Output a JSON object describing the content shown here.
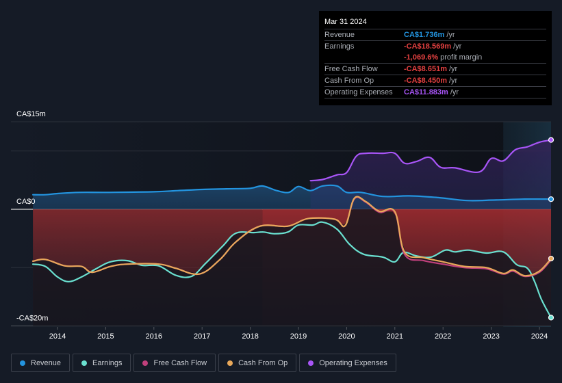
{
  "tooltip": {
    "date": "Mar 31 2024",
    "rows": [
      {
        "label": "Revenue",
        "value": "CA$1.736m",
        "unit": "/yr",
        "color": "#2394df"
      },
      {
        "label": "Earnings",
        "value": "-CA$18.569m",
        "unit": "/yr",
        "color": "#e64141"
      },
      {
        "label": "",
        "value": "-1,069.6%",
        "unit": "profit margin",
        "color": "#e64141"
      },
      {
        "label": "Free Cash Flow",
        "value": "-CA$8.651m",
        "unit": "/yr",
        "color": "#e64141"
      },
      {
        "label": "Cash From Op",
        "value": "-CA$8.450m",
        "unit": "/yr",
        "color": "#e64141"
      },
      {
        "label": "Operating Expenses",
        "value": "CA$11.883m",
        "unit": "/yr",
        "color": "#a855f7"
      }
    ]
  },
  "legend": [
    {
      "label": "Revenue",
      "color": "#2394df"
    },
    {
      "label": "Earnings",
      "color": "#6ae0d0"
    },
    {
      "label": "Free Cash Flow",
      "color": "#c0407c"
    },
    {
      "label": "Cash From Op",
      "color": "#e8a85a"
    },
    {
      "label": "Operating Expenses",
      "color": "#a855f7"
    }
  ],
  "chart_data": {
    "type": "line",
    "title": "",
    "xlabel": "",
    "ylabel": "",
    "ylim": [
      -20,
      15
    ],
    "xlim": [
      2013.5,
      2024.25
    ],
    "y_tick_labels": [
      {
        "value": 15,
        "label": "CA$15m"
      },
      {
        "value": 0,
        "label": "CA$0"
      },
      {
        "value": -20,
        "label": "-CA$20m"
      }
    ],
    "gridlines": [
      15,
      10,
      0,
      -10,
      -20
    ],
    "x_ticks": [
      2014,
      2015,
      2016,
      2017,
      2018,
      2019,
      2020,
      2021,
      2022,
      2023,
      2024
    ],
    "highlight_start": 2023.25,
    "units": "CA$ millions",
    "legend_position": "bottom",
    "series": [
      {
        "name": "Revenue",
        "color": "#2394df",
        "fill": true,
        "x": [
          2013.49,
          2013.75,
          2014.0,
          2014.45,
          2015.0,
          2016.0,
          2016.5,
          2017.0,
          2017.5,
          2018.0,
          2018.25,
          2018.55,
          2018.8,
          2019.0,
          2019.25,
          2019.5,
          2019.8,
          2020.0,
          2020.3,
          2020.75,
          2021.3,
          2021.9,
          2022.5,
          2023.1,
          2023.7,
          2024.25
        ],
        "values": [
          2.5,
          2.5,
          2.7,
          2.9,
          2.9,
          3.0,
          3.2,
          3.4,
          3.5,
          3.6,
          4.0,
          3.2,
          2.9,
          3.9,
          3.2,
          4.0,
          4.0,
          2.9,
          2.9,
          2.2,
          2.3,
          2.0,
          1.5,
          1.6,
          1.75,
          1.736
        ]
      },
      {
        "name": "Operating Expenses",
        "color": "#a855f7",
        "fill": true,
        "x": [
          2019.25,
          2019.5,
          2019.8,
          2020.0,
          2020.2,
          2020.4,
          2020.75,
          2021.0,
          2021.2,
          2021.45,
          2021.72,
          2021.95,
          2022.25,
          2022.75,
          2023.0,
          2023.25,
          2023.5,
          2023.75,
          2024.0,
          2024.25
        ],
        "values": [
          4.9,
          5.1,
          5.9,
          6.3,
          9.1,
          9.6,
          9.6,
          9.6,
          7.9,
          8.2,
          8.9,
          7.2,
          7.1,
          6.4,
          8.7,
          8.3,
          10.2,
          10.7,
          11.5,
          11.883
        ]
      },
      {
        "name": "Earnings",
        "color": "#6ae0d0",
        "fill": false,
        "x": [
          2013.49,
          2013.75,
          2014.0,
          2014.23,
          2014.5,
          2014.8,
          2015.1,
          2015.45,
          2015.75,
          2016.1,
          2016.45,
          2016.78,
          2017.07,
          2017.43,
          2017.7,
          2018.07,
          2018.28,
          2018.5,
          2018.78,
          2019.0,
          2019.3,
          2019.5,
          2019.8,
          2020.06,
          2020.35,
          2020.75,
          2021.0,
          2021.18,
          2021.45,
          2021.75,
          2022.05,
          2022.25,
          2022.52,
          2022.9,
          2023.25,
          2023.53,
          2023.75,
          2023.9,
          2024.04,
          2024.25
        ],
        "values": [
          -9.4,
          -9.8,
          -11.6,
          -12.4,
          -11.6,
          -10.2,
          -9.0,
          -8.8,
          -9.6,
          -9.7,
          -11.3,
          -11.5,
          -9.3,
          -6.3,
          -4.1,
          -4.0,
          -3.9,
          -4.2,
          -3.9,
          -2.7,
          -2.7,
          -2.2,
          -3.4,
          -6.0,
          -7.7,
          -8.2,
          -9.0,
          -7.4,
          -8.0,
          -8.2,
          -7.0,
          -7.3,
          -7.0,
          -7.5,
          -7.3,
          -9.5,
          -10.1,
          -12.4,
          -15.4,
          -18.569
        ]
      },
      {
        "name": "Free Cash Flow",
        "color": "#c0407c",
        "fill": false,
        "x": [
          2013.49,
          2013.75,
          2014.15,
          2014.5,
          2014.72,
          2015.1,
          2015.45,
          2016.1,
          2016.45,
          2016.94,
          2017.36,
          2017.7,
          2018.2,
          2018.78,
          2019.2,
          2019.75,
          2019.97,
          2020.16,
          2020.4,
          2020.68,
          2021.0,
          2021.2,
          2021.6,
          2022.0,
          2022.45,
          2022.9,
          2023.25,
          2023.45,
          2023.7,
          2024.0,
          2024.25
        ],
        "values": [
          -8.9,
          -8.6,
          -9.7,
          -9.8,
          -10.8,
          -9.8,
          -9.4,
          -9.4,
          -10.1,
          -11.1,
          -8.7,
          -5.6,
          -2.9,
          -2.9,
          -1.6,
          -1.7,
          -2.8,
          1.8,
          1.2,
          -0.5,
          -0.5,
          -7.7,
          -8.8,
          -9.4,
          -10.0,
          -10.2,
          -11.1,
          -10.6,
          -11.5,
          -10.8,
          -8.651
        ]
      },
      {
        "name": "Cash From Op",
        "color": "#e8a85a",
        "fill": false,
        "x": [
          2013.49,
          2013.75,
          2014.15,
          2014.5,
          2014.72,
          2015.1,
          2015.45,
          2016.1,
          2016.45,
          2016.94,
          2017.36,
          2017.7,
          2018.2,
          2018.78,
          2019.2,
          2019.75,
          2019.97,
          2020.16,
          2020.4,
          2020.68,
          2021.0,
          2021.2,
          2021.6,
          2022.0,
          2022.45,
          2022.9,
          2023.25,
          2023.45,
          2023.7,
          2024.0,
          2024.25
        ],
        "values": [
          -8.9,
          -8.6,
          -9.7,
          -9.8,
          -10.8,
          -9.8,
          -9.4,
          -9.4,
          -10.1,
          -11.1,
          -8.7,
          -5.6,
          -2.9,
          -2.9,
          -1.6,
          -1.7,
          -2.8,
          1.9,
          1.3,
          -0.35,
          -0.4,
          -7.3,
          -8.3,
          -9.0,
          -9.8,
          -10.0,
          -11.0,
          -10.4,
          -11.4,
          -10.6,
          -8.45
        ]
      }
    ]
  }
}
